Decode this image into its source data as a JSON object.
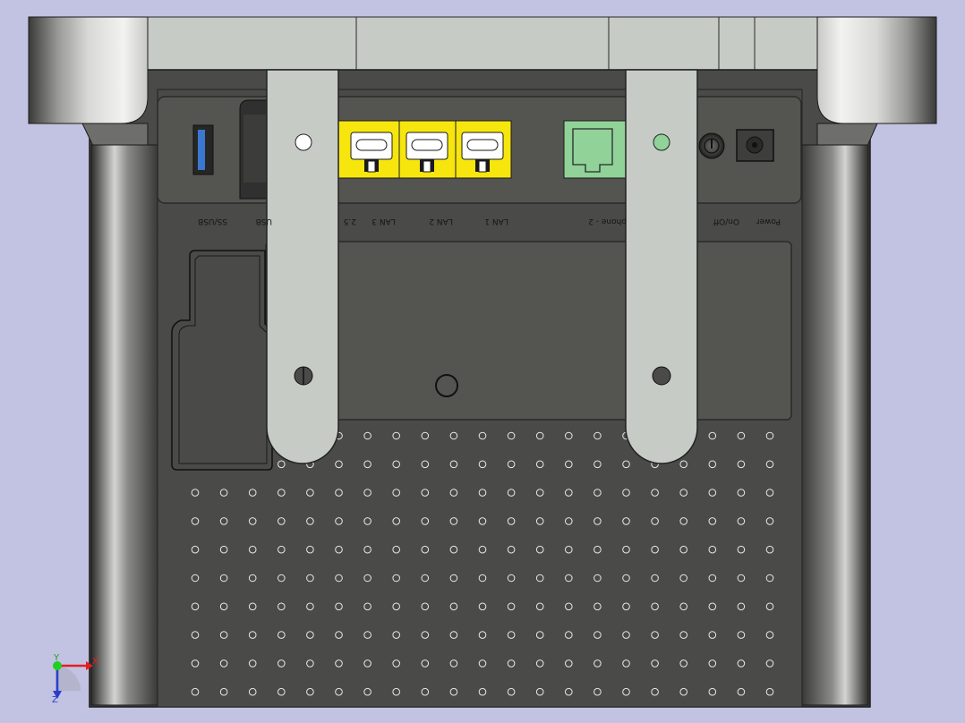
{
  "port_labels": [
    {
      "id": "ss-usb",
      "text": "SS/USB"
    },
    {
      "id": "usb",
      "text": "USB"
    },
    {
      "id": "2.5",
      "text": "2.5"
    },
    {
      "id": "lan3",
      "text": "LAN 3"
    },
    {
      "id": "lan2",
      "text": "LAN 2"
    },
    {
      "id": "lan1",
      "text": "LAN 1"
    },
    {
      "id": "phone2",
      "text": "phone - 2"
    },
    {
      "id": "onoff",
      "text": "On/Off"
    },
    {
      "id": "power",
      "text": "Power"
    }
  ],
  "axes": {
    "x": "X",
    "y": "Y",
    "z": "Z"
  },
  "colors": {
    "background": "#c2c2e2",
    "body_dark": "#4a4a48",
    "port_panel": "#545550",
    "lan_yellow": "#f6e60e",
    "phone_green": "#90d298",
    "usb_blue": "#3a78d0",
    "antenna_grey": "#c6cbc6"
  },
  "vent_grid": {
    "columns": 21,
    "rows": 10
  }
}
